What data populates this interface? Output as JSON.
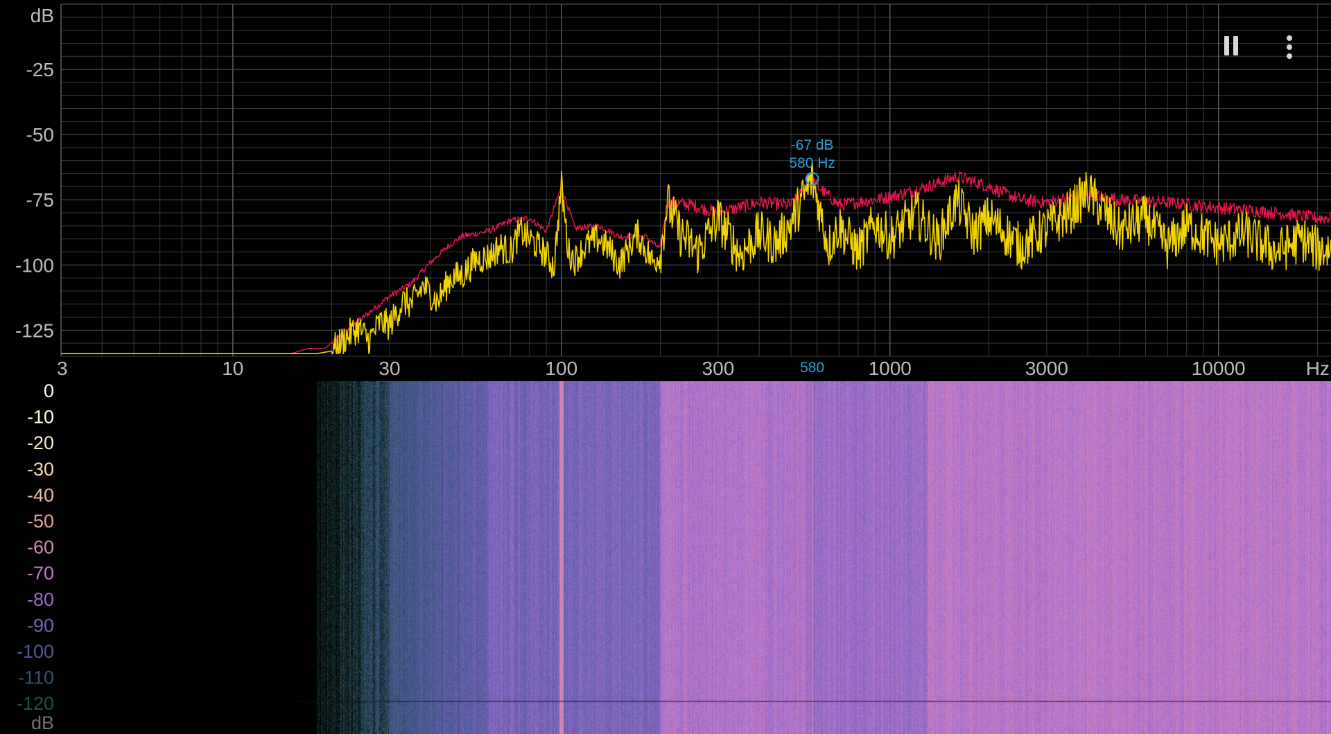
{
  "toolbar": {
    "pause_icon": "pause-icon",
    "menu_icon": "more-vert-icon"
  },
  "colors": {
    "background": "#000000",
    "grid": "#3a3a3a",
    "grid_major": "#5a5a5a",
    "axis_text": "#bdbdbd",
    "peak_hold": "#e0184c",
    "live_spectrum": "#f2d400",
    "marker": "#2a9fd6"
  },
  "marker": {
    "db_label": "-67 dB",
    "hz_label": "580 Hz",
    "axis_label": "580",
    "frequency_hz": 580,
    "level_db": -67
  },
  "chart_data": [
    {
      "type": "line",
      "y_unit_label": "dB",
      "x_unit_label": "Hz",
      "x_scale": "log",
      "xlim": [
        3,
        22000
      ],
      "ylim": [
        -135,
        0
      ],
      "x_tick_labels": [
        "3",
        "10",
        "30",
        "100",
        "300",
        "1000",
        "3000",
        "10000"
      ],
      "x_tick_values": [
        3,
        10,
        30,
        100,
        300,
        1000,
        3000,
        10000
      ],
      "y_tick_labels": [
        "-25",
        "-50",
        "-75",
        "-100",
        "-125"
      ],
      "y_tick_values": [
        -25,
        -50,
        -75,
        -100,
        -125
      ],
      "grid": true,
      "series": [
        {
          "color": "#e0184c",
          "points": [
            [
              3,
              -134
            ],
            [
              15,
              -134
            ],
            [
              17,
              -132
            ],
            [
              19,
              -132
            ],
            [
              21,
              -128
            ],
            [
              25,
              -120
            ],
            [
              30,
              -112
            ],
            [
              35,
              -107
            ],
            [
              40,
              -99
            ],
            [
              45,
              -93
            ],
            [
              50,
              -89
            ],
            [
              55,
              -88
            ],
            [
              60,
              -87
            ],
            [
              70,
              -83
            ],
            [
              80,
              -82
            ],
            [
              90,
              -87
            ],
            [
              100,
              -70
            ],
            [
              110,
              -86
            ],
            [
              130,
              -85
            ],
            [
              150,
              -89
            ],
            [
              180,
              -89
            ],
            [
              200,
              -94
            ],
            [
              210,
              -76
            ],
            [
              250,
              -77
            ],
            [
              300,
              -80
            ],
            [
              400,
              -76
            ],
            [
              500,
              -77
            ],
            [
              580,
              -68
            ],
            [
              700,
              -77
            ],
            [
              1000,
              -74
            ],
            [
              1300,
              -70
            ],
            [
              1600,
              -66
            ],
            [
              2000,
              -70
            ],
            [
              2500,
              -75
            ],
            [
              3000,
              -76
            ],
            [
              4000,
              -73
            ],
            [
              5000,
              -75
            ],
            [
              7000,
              -76
            ],
            [
              10000,
              -78
            ],
            [
              15000,
              -80
            ],
            [
              20000,
              -82
            ]
          ]
        },
        {
          "color": "#f2d400",
          "points": [
            [
              3,
              -134
            ],
            [
              18,
              -134
            ],
            [
              20,
              -133
            ],
            [
              22,
              -128
            ],
            [
              24,
              -124
            ],
            [
              26,
              -129
            ],
            [
              28,
              -122
            ],
            [
              30,
              -123
            ],
            [
              33,
              -114
            ],
            [
              35,
              -115
            ],
            [
              38,
              -108
            ],
            [
              42,
              -114
            ],
            [
              46,
              -105
            ],
            [
              50,
              -104
            ],
            [
              55,
              -98
            ],
            [
              60,
              -97
            ],
            [
              65,
              -93
            ],
            [
              70,
              -95
            ],
            [
              75,
              -87
            ],
            [
              80,
              -90
            ],
            [
              85,
              -93
            ],
            [
              90,
              -96
            ],
            [
              95,
              -101
            ],
            [
              100,
              -69
            ],
            [
              105,
              -95
            ],
            [
              110,
              -98
            ],
            [
              120,
              -92
            ],
            [
              130,
              -90
            ],
            [
              140,
              -94
            ],
            [
              150,
              -100
            ],
            [
              170,
              -88
            ],
            [
              190,
              -99
            ],
            [
              200,
              -96
            ],
            [
              210,
              -76
            ],
            [
              230,
              -88
            ],
            [
              260,
              -95
            ],
            [
              300,
              -82
            ],
            [
              350,
              -96
            ],
            [
              400,
              -88
            ],
            [
              450,
              -92
            ],
            [
              500,
              -84
            ],
            [
              580,
              -67
            ],
            [
              650,
              -93
            ],
            [
              700,
              -85
            ],
            [
              800,
              -95
            ],
            [
              900,
              -84
            ],
            [
              1000,
              -90
            ],
            [
              1200,
              -80
            ],
            [
              1400,
              -91
            ],
            [
              1600,
              -75
            ],
            [
              1800,
              -88
            ],
            [
              2000,
              -82
            ],
            [
              2500,
              -93
            ],
            [
              3000,
              -86
            ],
            [
              3500,
              -80
            ],
            [
              4000,
              -72
            ],
            [
              5000,
              -87
            ],
            [
              6000,
              -82
            ],
            [
              7000,
              -93
            ],
            [
              8000,
              -85
            ],
            [
              10000,
              -92
            ],
            [
              12000,
              -88
            ],
            [
              15000,
              -95
            ],
            [
              18000,
              -90
            ],
            [
              20000,
              -94
            ]
          ]
        }
      ]
    },
    {
      "type": "heatmap",
      "y_unit_label": "dB",
      "colorbar_labels": [
        "0",
        "-10",
        "-20",
        "-30",
        "-40",
        "-50",
        "-60",
        "-70",
        "-80",
        "-90",
        "-100",
        "-110",
        "-120"
      ],
      "colorbar_values": [
        0,
        -10,
        -20,
        -30,
        -40,
        -50,
        -60,
        -70,
        -80,
        -90,
        -100,
        -110,
        -120
      ],
      "colorbar_colors": [
        "#ffffff",
        "#ffffe6",
        "#f9eccc",
        "#f4d9b5",
        "#eebfa6",
        "#e5a3a2",
        "#d889b0",
        "#c07ac4",
        "#9a6ccc",
        "#7463b7",
        "#4f5a98",
        "#365274",
        "#21504e"
      ]
    }
  ]
}
